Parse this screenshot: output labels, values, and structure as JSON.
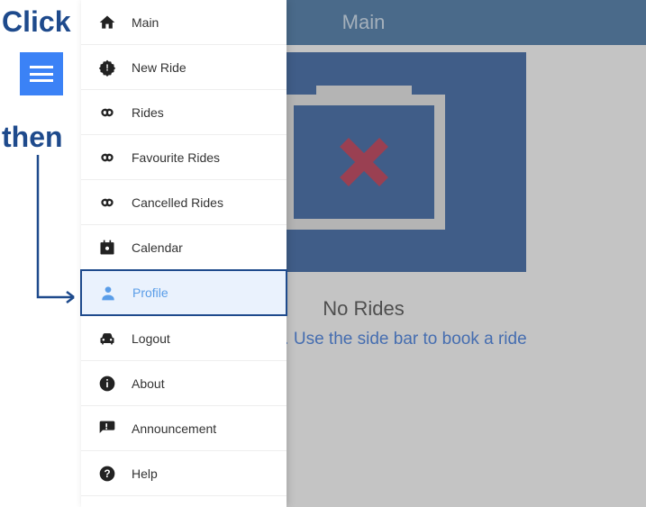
{
  "annotations": {
    "click": "Click",
    "then": "then"
  },
  "header": {
    "title": "Main"
  },
  "main": {
    "no_rides_title": "No Rides",
    "no_rides_sub": "nding rides. Use the side bar to book a ride"
  },
  "sidebar": {
    "items": [
      {
        "id": "main",
        "label": "Main",
        "icon": "home"
      },
      {
        "id": "new-ride",
        "label": "New Ride",
        "icon": "badge"
      },
      {
        "id": "rides",
        "label": "Rides",
        "icon": "infinity"
      },
      {
        "id": "favourite-rides",
        "label": "Favourite Rides",
        "icon": "infinity"
      },
      {
        "id": "cancelled-rides",
        "label": "Cancelled Rides",
        "icon": "infinity"
      },
      {
        "id": "calendar",
        "label": "Calendar",
        "icon": "calendar"
      },
      {
        "id": "profile",
        "label": "Profile",
        "icon": "person",
        "selected": true
      },
      {
        "id": "logout",
        "label": "Logout",
        "icon": "car"
      },
      {
        "id": "about",
        "label": "About",
        "icon": "info"
      },
      {
        "id": "announcement",
        "label": "Announcement",
        "icon": "announcement"
      },
      {
        "id": "help",
        "label": "Help",
        "icon": "help"
      }
    ]
  }
}
